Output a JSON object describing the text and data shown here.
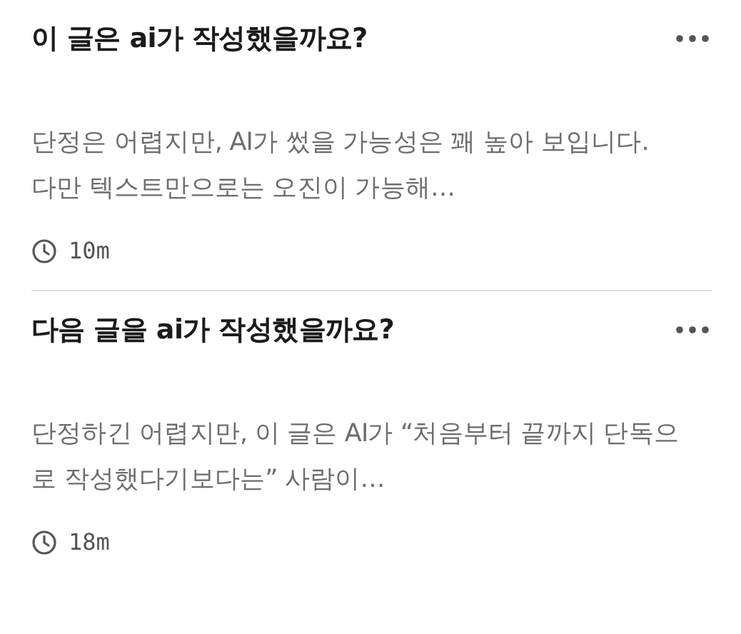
{
  "conversations": [
    {
      "title": "이 글은 ai가 작성했을까요?",
      "preview": "단정은 어렵지만, AI가 썼을 가능성은 꽤 높아 보입니다. 다만 텍스트만으로는 오진이 가능해…",
      "time": "10m"
    },
    {
      "title": "다음 글을 ai가 작성했을까요?",
      "preview": "단정하긴 어렵지만, 이 글은 AI가 “처음부터 끝까지 단독으로 작성했다기보다는” 사람이…",
      "time": "18m"
    }
  ]
}
